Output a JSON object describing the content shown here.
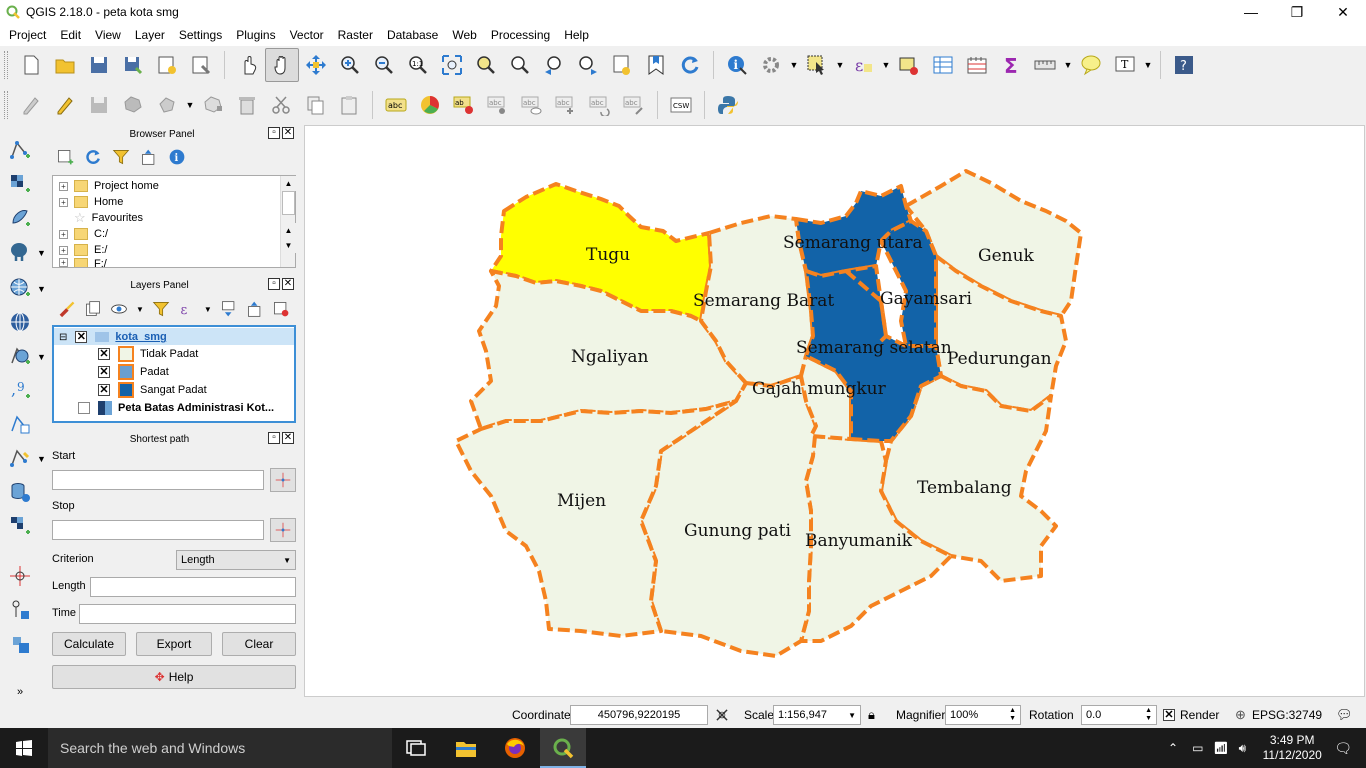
{
  "window": {
    "title": "QGIS 2.18.0 - peta kota smg",
    "minimize": "—",
    "maximize": "❐",
    "close": "✕"
  },
  "menu": [
    "Project",
    "Edit",
    "View",
    "Layer",
    "Settings",
    "Plugins",
    "Vector",
    "Raster",
    "Database",
    "Web",
    "Processing",
    "Help"
  ],
  "browser_panel": {
    "title": "Browser Panel",
    "items": [
      "Project home",
      "Home",
      "Favourites",
      "C:/",
      "E:/",
      "F:/"
    ]
  },
  "layers_panel": {
    "title": "Layers Panel",
    "group_layer": "kota_smg",
    "classes": [
      {
        "label": "Tidak Padat",
        "color": "#f0f5e6",
        "border": "#f5821f"
      },
      {
        "label": "Padat",
        "color": "#6a9fd0",
        "border": "#f5821f"
      },
      {
        "label": "Sangat Padat",
        "color": "#1263a8",
        "border": "#f5821f"
      }
    ],
    "raster_layer": "Peta Batas Administrasi Kot..."
  },
  "shortest_path": {
    "title": "Shortest path",
    "start_label": "Start",
    "start_value": "",
    "stop_label": "Stop",
    "stop_value": "",
    "criterion_label": "Criterion",
    "criterion_value": "Length",
    "length_label": "Length",
    "length_value": "",
    "time_label": "Time",
    "time_value": "",
    "calculate": "Calculate",
    "export": "Export",
    "clear": "Clear",
    "help": "Help"
  },
  "map": {
    "colors": {
      "tidak_padat": "#f0f5e6",
      "sangat_padat": "#1263a8",
      "selected": "#ffff00",
      "boundary": "#f5821f"
    },
    "labels": {
      "tugu": "Tugu",
      "semarang_utara": "Semarang utara",
      "genuk": "Genuk",
      "semarang_barat": "Semarang Barat",
      "gayamsari": "Gayamsari",
      "ngaliyan": "Ngaliyan",
      "semarang_selatan": "Semarang selatan",
      "pedurungan": "Pedurungan",
      "gajah_mungkur": "Gajah mungkur",
      "mijen": "Mijen",
      "tembalang": "Tembalang",
      "gunung_pati": "Gunung pati",
      "banyumanik": "Banyumanik"
    }
  },
  "statusbar": {
    "coordinate_label": "Coordinate",
    "coordinate_value": "450796,9220195",
    "scale_label": "Scale",
    "scale_value": "1:156,947",
    "magnifier_label": "Magnifier",
    "magnifier_value": "100%",
    "rotation_label": "Rotation",
    "rotation_value": "0.0",
    "render_label": "Render",
    "crs": "EPSG:32749"
  },
  "taskbar": {
    "search_placeholder": "Search the web and Windows",
    "time": "3:49 PM",
    "date": "11/12/2020"
  }
}
